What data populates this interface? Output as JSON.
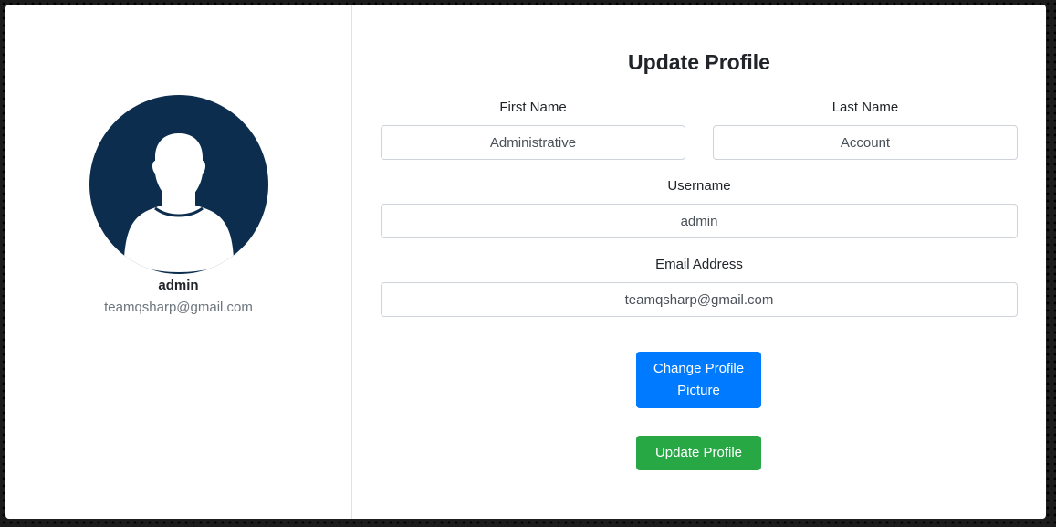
{
  "profile": {
    "avatar_icon": "user-silhouette-icon",
    "name": "admin",
    "email": "teamqsharp@gmail.com"
  },
  "form": {
    "title": "Update Profile",
    "first_name": {
      "label": "First Name",
      "value": "Administrative"
    },
    "last_name": {
      "label": "Last Name",
      "value": "Account"
    },
    "username": {
      "label": "Username",
      "value": "admin"
    },
    "email": {
      "label": "Email Address",
      "value": "teamqsharp@gmail.com"
    },
    "change_picture_label": "Change Profile Picture",
    "submit_label": "Update Profile"
  },
  "colors": {
    "avatar_bg": "#0c2d4e",
    "primary_button": "#007bff",
    "success_button": "#28a745"
  }
}
